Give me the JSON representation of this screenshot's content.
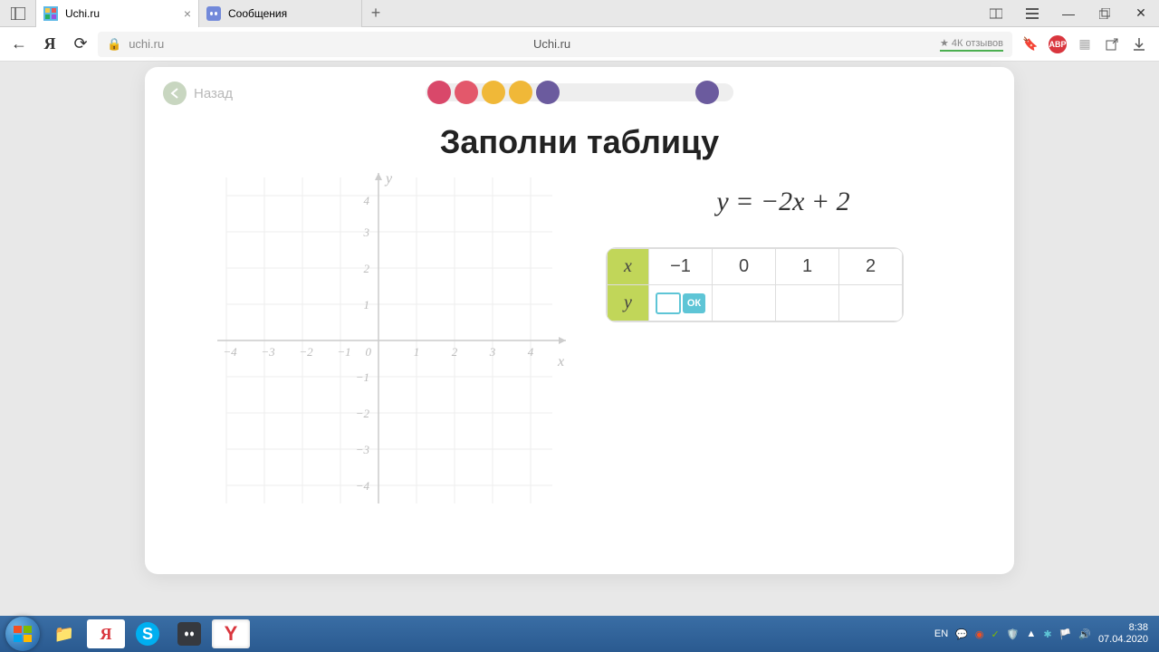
{
  "browser": {
    "tabs": [
      {
        "title": "Uchi.ru",
        "active": true
      },
      {
        "title": "Сообщения",
        "active": false
      }
    ],
    "address": "uchi.ru",
    "page_title": "Uchi.ru",
    "reviews": "★ 4К отзывов"
  },
  "page": {
    "back_label": "Назад",
    "title": "Заполни таблицу",
    "equation": "y = −2x + 2",
    "table": {
      "x_label": "x",
      "y_label": "y",
      "x_values": [
        "−1",
        "0",
        "1",
        "2"
      ],
      "y_values": [
        "",
        "",
        "",
        ""
      ],
      "ok_label": "ОК"
    },
    "axes": {
      "x_ticks": [
        "−4",
        "−3",
        "−2",
        "−1",
        "0",
        "1",
        "2",
        "3",
        "4"
      ],
      "y_ticks_pos": [
        "1",
        "2",
        "3",
        "4"
      ],
      "y_ticks_neg": [
        "−1",
        "−2",
        "−3",
        "−4"
      ],
      "x_label": "x",
      "y_label": "y"
    }
  },
  "taskbar": {
    "lang": "EN",
    "time": "8:38",
    "date": "07.04.2020"
  }
}
